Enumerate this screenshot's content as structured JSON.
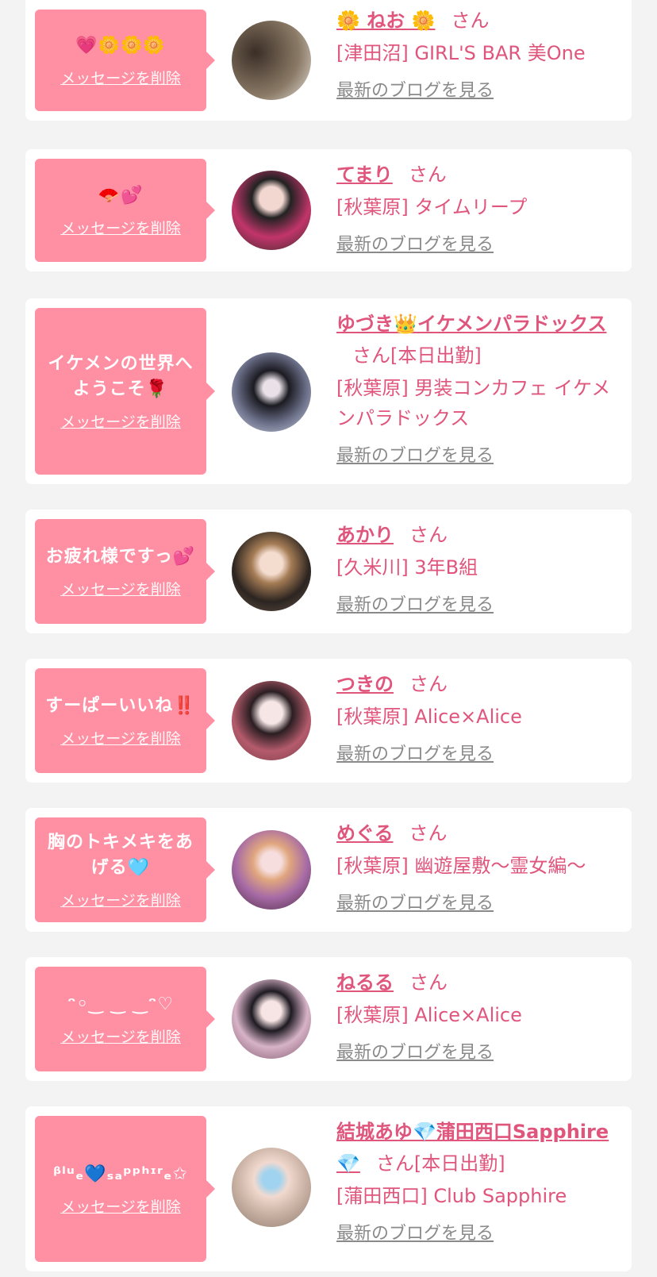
{
  "delete_label": "メッセージを削除",
  "san_label": "さん",
  "blog_label": "最新のブログを見る",
  "cards": [
    {
      "message": "💗🌼🌼🌼",
      "name": "🌼 ねお 🌼",
      "status": "",
      "shop": "[津田沼] GIRL'S BAR 美One"
    },
    {
      "message": "🪭💕",
      "name": "てまり",
      "status": "",
      "shop": "[秋葉原] タイムリープ"
    },
    {
      "message": "イケメンの世界へようこそ🌹",
      "name": "ゆづき👑イケメンパラドックス",
      "status": "[本日出勤]",
      "shop": "[秋葉原] 男装コンカフェ イケメンパラドックス"
    },
    {
      "message": "お疲れ様ですっ💕",
      "name": "あかり",
      "status": "",
      "shop": "[久米川] 3年B組"
    },
    {
      "message": "すーぱーいいね‼️",
      "name": "つきの",
      "status": "",
      "shop": "[秋葉原] Alice×Alice"
    },
    {
      "message": "胸のトキメキをあげる🩵",
      "name": "めぐる",
      "status": "",
      "shop": "[秋葉原] 幽遊屋敷〜霊女編〜"
    },
    {
      "message": "ᵔ◦‿ ‿ ‿ᵔ♡",
      "name": "ねるる",
      "status": "",
      "shop": "[秋葉原] Alice×Alice"
    },
    {
      "message": "ᵝˡᵘₑ💙ₛₐᵖᵖʰᶦʳₑ✩",
      "name": "結城あゆ💎蒲田西口Sapphire💎",
      "status": "[本日出勤]",
      "shop": "[蒲田西口] Club Sapphire"
    }
  ],
  "colors": {
    "accent": "#e0557c",
    "bubble": "#ff8fa3",
    "link_gray": "#8a8a8a"
  }
}
